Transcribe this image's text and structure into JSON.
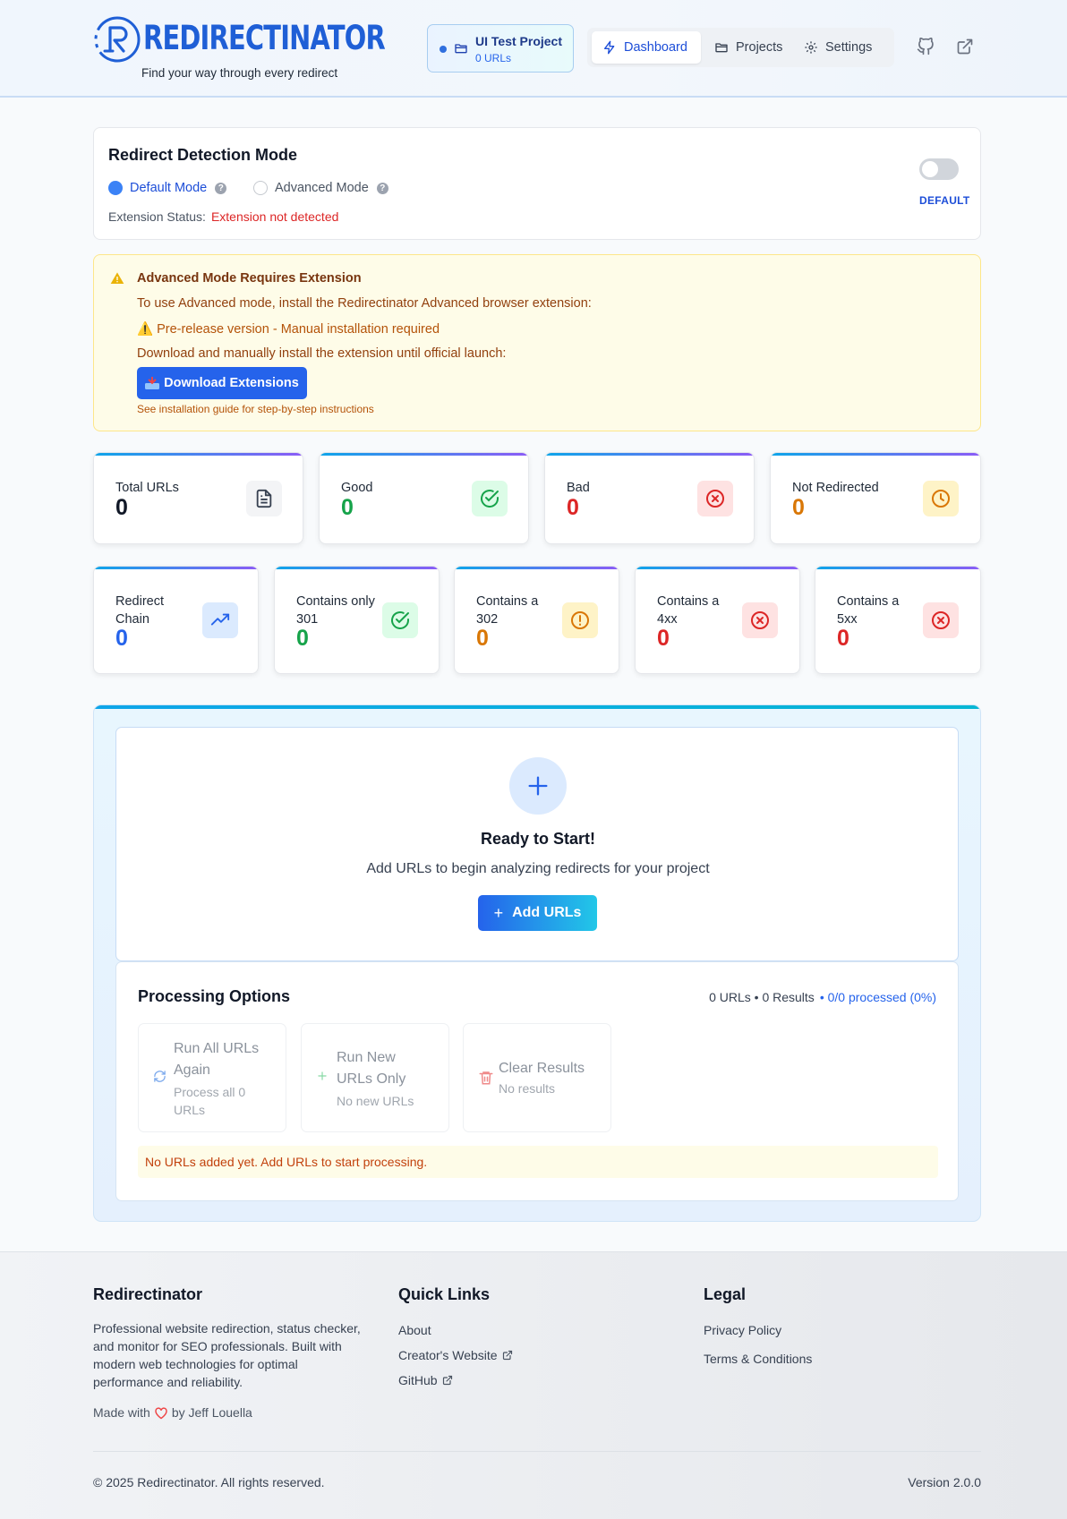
{
  "brand": {
    "name": "REDIRECTINATOR",
    "tagline": "Find your way through every redirect",
    "color": "#1f5fd6"
  },
  "project": {
    "name": "UI Test Project",
    "url_count": "0 URLs"
  },
  "nav": {
    "items": [
      {
        "label": "Dashboard",
        "icon": "bolt-icon",
        "active": true
      },
      {
        "label": "Projects",
        "icon": "folder-icon",
        "active": false
      },
      {
        "label": "Settings",
        "icon": "gear-icon",
        "active": false
      }
    ],
    "github_icon": "github-icon",
    "external_icon": "external-link-icon"
  },
  "mode": {
    "title": "Redirect Detection Mode",
    "default_label": "Default Mode",
    "advanced_label": "Advanced Mode",
    "help_glyph": "?",
    "selected": "default",
    "ext_status_label": "Extension Status:",
    "ext_status_value": "Extension not detected",
    "toggle_label": "DEFAULT",
    "toggle_on": false
  },
  "warning": {
    "title": "Advanced Mode Requires Extension",
    "line1": "To use Advanced mode, install the Redirectinator Advanced browser extension:",
    "prerelease": "⚠️ Pre-release version - Manual installation required",
    "line3": "Download and manually install the extension until official launch:",
    "button": "Download Extensions",
    "guide": "See installation guide for step-by-step instructions"
  },
  "stats_top": [
    {
      "label": "Total URLs",
      "value": "0",
      "color": "#111827",
      "icon": "document-icon",
      "bg": "#f3f4f6",
      "fg": "#374151"
    },
    {
      "label": "Good",
      "value": "0",
      "color": "#16a34a",
      "icon": "check-circle-icon",
      "bg": "#dcfce7",
      "fg": "#16a34a"
    },
    {
      "label": "Bad",
      "value": "0",
      "color": "#dc2626",
      "icon": "x-circle-icon",
      "bg": "#fee2e2",
      "fg": "#dc2626"
    },
    {
      "label": "Not Redirected",
      "value": "0",
      "color": "#d97706",
      "icon": "clock-icon",
      "bg": "#fef3c7",
      "fg": "#d97706"
    }
  ],
  "stats_bottom": [
    {
      "label_1": "Redirect",
      "label_2": "Chain",
      "value": "0",
      "color": "#2563eb",
      "icon": "trending-up-icon",
      "bg": "#dbeafe",
      "fg": "#2563eb"
    },
    {
      "label_1": "Contains only",
      "label_2": "301",
      "value": "0",
      "color": "#16a34a",
      "icon": "check-circle-icon",
      "bg": "#dcfce7",
      "fg": "#16a34a"
    },
    {
      "label_1": "Contains a",
      "label_2": "302",
      "value": "0",
      "color": "#d97706",
      "icon": "alert-circle-icon",
      "bg": "#fef3c7",
      "fg": "#d97706"
    },
    {
      "label_1": "Contains a",
      "label_2": "4xx",
      "value": "0",
      "color": "#dc2626",
      "icon": "x-circle-icon",
      "bg": "#fee2e2",
      "fg": "#dc2626"
    },
    {
      "label_1": "Contains a",
      "label_2": "5xx",
      "value": "0",
      "color": "#dc2626",
      "icon": "x-circle-icon",
      "bg": "#fee2e2",
      "fg": "#dc2626"
    }
  ],
  "start": {
    "title": "Ready to Start!",
    "subtitle": "Add URLs to begin analyzing redirects for your project",
    "button": "Add URLs",
    "plus_glyph": "+"
  },
  "processing": {
    "title": "Processing Options",
    "summary_counts": "0 URLs • 0 Results",
    "summary_processed": "• 0/0 processed (0%)",
    "options": [
      {
        "title_1": "Run All URLs",
        "title_2": "Again",
        "sub_1": "Process all 0",
        "sub_2": "URLs",
        "icon": "refresh-icon"
      },
      {
        "title_1": "Run New",
        "title_2": "URLs Only",
        "sub_1": "No new URLs",
        "icon": "plus-icon"
      },
      {
        "title_1": "Clear Results",
        "sub_1": "No results",
        "icon": "trash-icon"
      }
    ],
    "note": "No URLs added yet. Add URLs to start processing."
  },
  "footer": {
    "brand_title": "Redirectinator",
    "description": "Professional website redirection, status checker, and monitor for SEO professionals. Built with modern web technologies for optimal performance and reliability.",
    "made_with": "Made with",
    "made_by": "by Jeff Louella",
    "quick_links_title": "Quick Links",
    "quick_links": [
      "About",
      "Creator's Website",
      "GitHub"
    ],
    "legal_title": "Legal",
    "legal_links": [
      "Privacy Policy",
      "Terms & Conditions"
    ],
    "copyright": "© 2025 Redirectinator. All rights reserved.",
    "version": "Version 2.0.0"
  }
}
